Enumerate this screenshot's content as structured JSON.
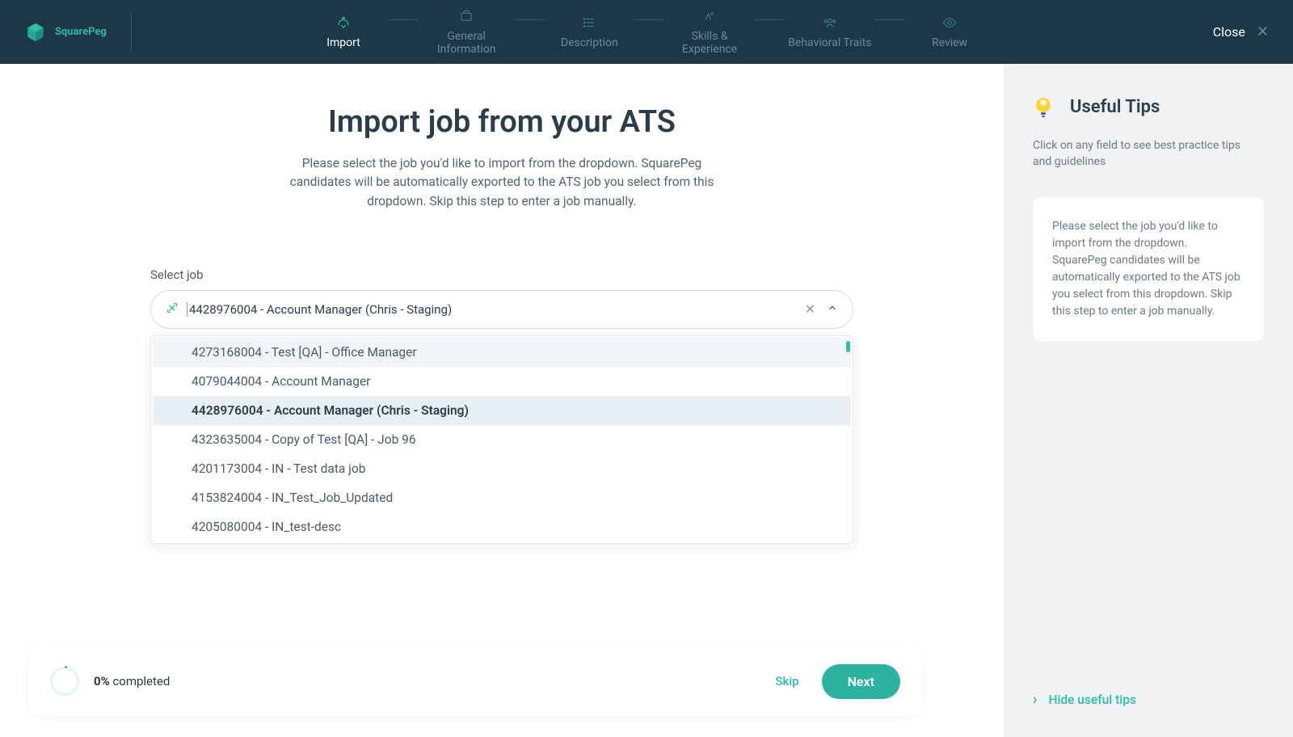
{
  "brand": {
    "name": "SquarePeg"
  },
  "header": {
    "close_label": "Close"
  },
  "nav": [
    {
      "label": "Import",
      "active": true
    },
    {
      "label": "General Information",
      "active": false
    },
    {
      "label": "Description",
      "active": false
    },
    {
      "label": "Skills & Experience",
      "active": false
    },
    {
      "label": "Behavioral Traits",
      "active": false
    },
    {
      "label": "Review",
      "active": false
    }
  ],
  "page": {
    "title": "Import job from your ATS",
    "subtitle": "Please select the job you'd like to import from the dropdown. SquarePeg candidates will be automatically exported to the ATS job you select from this dropdown. Skip this step to enter a job manually."
  },
  "select": {
    "label": "Select job",
    "value": "4428976004 - Account Manager (Chris - Staging)",
    "options": [
      {
        "label": "4273168004 - Test [QA] - Office Manager",
        "hover": true,
        "selected": false
      },
      {
        "label": "4079044004 - Account Manager",
        "hover": false,
        "selected": false
      },
      {
        "label": "4428976004 - Account Manager (Chris - Staging)",
        "hover": false,
        "selected": true
      },
      {
        "label": "4323635004 - Copy of Test [QA] - Job 96",
        "hover": false,
        "selected": false
      },
      {
        "label": "4201173004 - IN - Test data job",
        "hover": false,
        "selected": false
      },
      {
        "label": "4153824004 - IN_Test_Job_Updated",
        "hover": false,
        "selected": false
      },
      {
        "label": "4205080004 - IN_test-desc",
        "hover": false,
        "selected": false
      }
    ]
  },
  "progress": {
    "pct": "0%",
    "completed_label": " completed"
  },
  "actions": {
    "skip": "Skip",
    "next": "Next"
  },
  "tips": {
    "title": "Useful Tips",
    "sub": "Click on any field to see best practice tips and guidelines",
    "box": "Please select the job you'd like to import from the dropdown. SquarePeg candidates will be automatically exported to the ATS job you select from this dropdown. Skip this step to enter a job manually.",
    "hide": "Hide useful tips"
  }
}
